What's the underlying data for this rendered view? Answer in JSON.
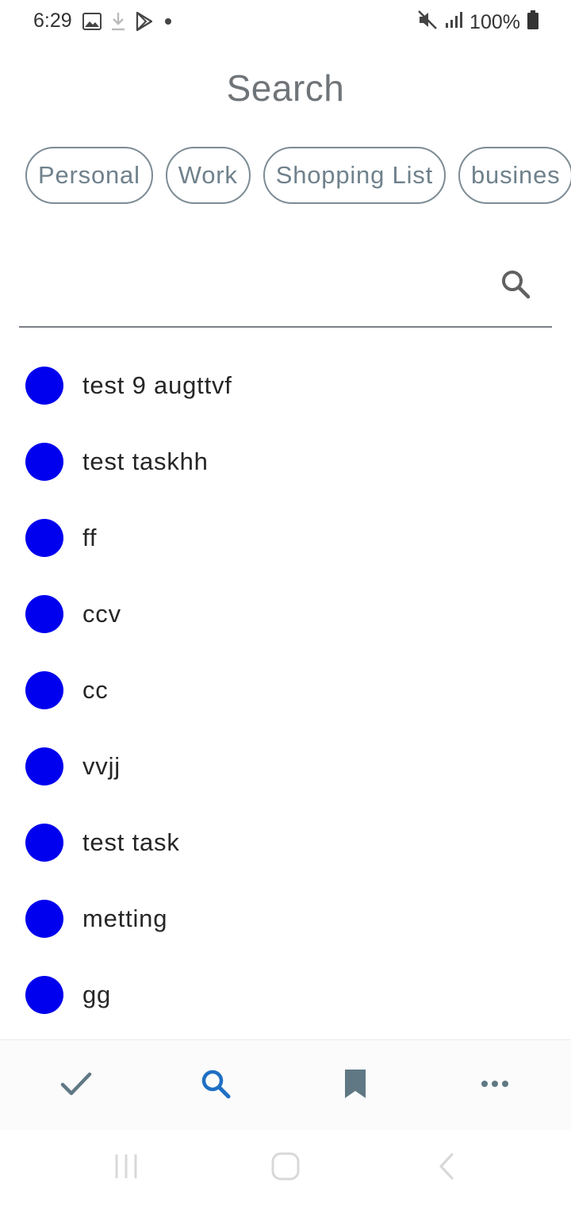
{
  "status_bar": {
    "time": "6:29",
    "battery_text": "100%",
    "left_icons": [
      "image-icon",
      "download-icon",
      "play-store-icon",
      "dot-icon"
    ],
    "right_icons": [
      "mute-icon",
      "signal-icon",
      "battery-icon"
    ]
  },
  "header": {
    "title": "Search"
  },
  "categories": [
    {
      "label": "Personal"
    },
    {
      "label": "Work"
    },
    {
      "label": "Shopping List"
    },
    {
      "label": "busines"
    }
  ],
  "search": {
    "value": "",
    "placeholder": "",
    "icon": "search-icon"
  },
  "tasks": [
    {
      "label": "test 9 augttvf",
      "color": "#0000ee"
    },
    {
      "label": "test taskhh",
      "color": "#0000ee"
    },
    {
      "label": "ff",
      "color": "#0000ee"
    },
    {
      "label": "ccv",
      "color": "#0000ee"
    },
    {
      "label": "cc",
      "color": "#0000ee"
    },
    {
      "label": "vvjj",
      "color": "#0000ee"
    },
    {
      "label": "test task",
      "color": "#0000ee"
    },
    {
      "label": "metting",
      "color": "#0000ee"
    },
    {
      "label": "gg",
      "color": "#0000ee"
    }
  ],
  "bottom_nav": {
    "items": [
      {
        "icon": "check-icon",
        "active": false
      },
      {
        "icon": "search-icon",
        "active": true
      },
      {
        "icon": "bookmark-icon",
        "active": false
      },
      {
        "icon": "more-icon",
        "active": false
      }
    ],
    "active_color": "#1f6fc4",
    "inactive_color": "#5f7884"
  },
  "system_nav": {
    "items": [
      "recents-icon",
      "home-icon",
      "back-icon"
    ]
  }
}
